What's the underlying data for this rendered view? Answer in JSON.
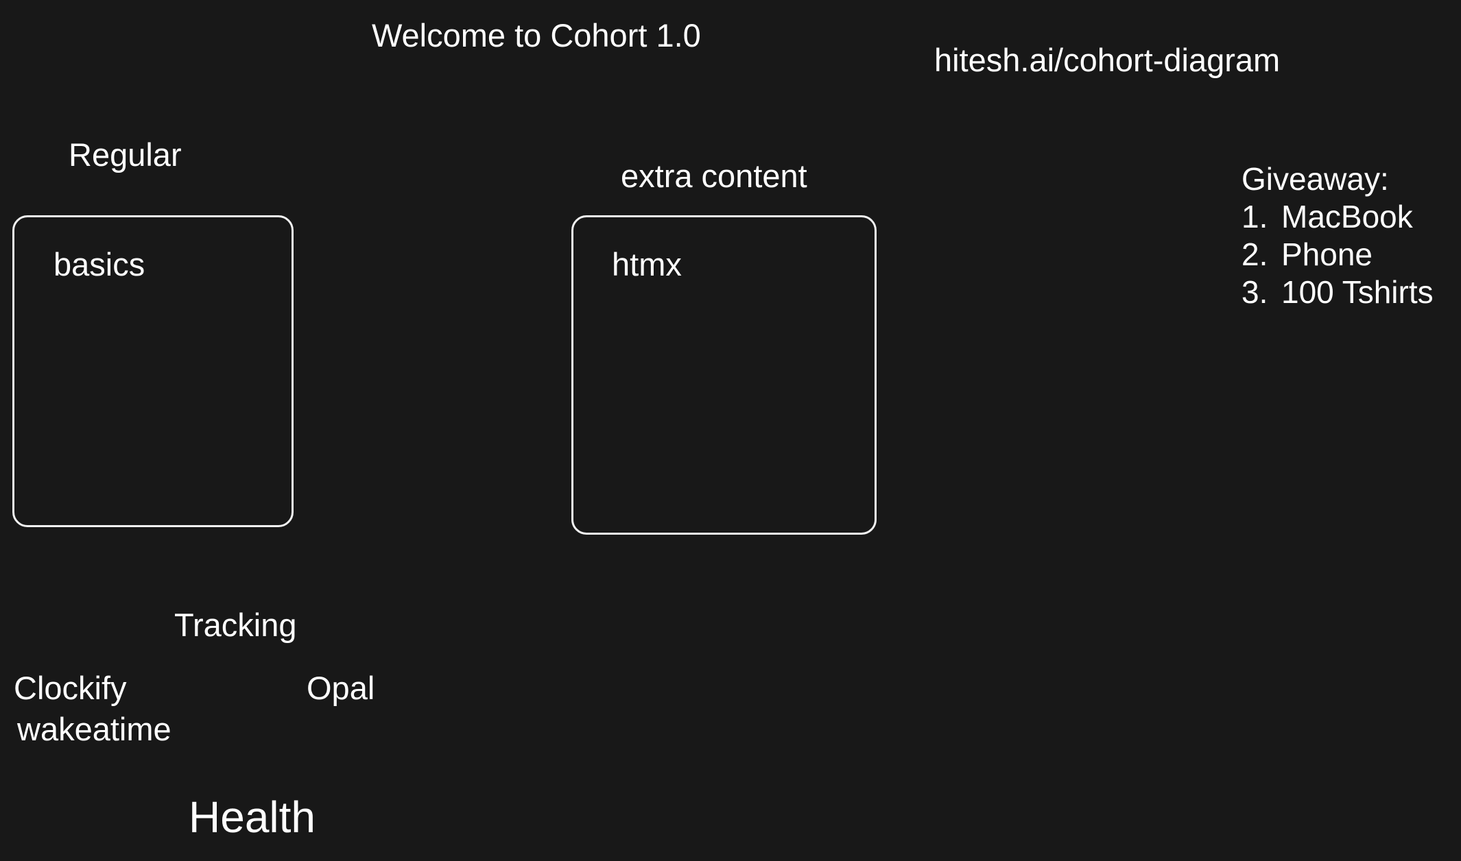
{
  "canvas": {
    "background": "#181818",
    "stroke_color": "#f2f2f2",
    "text_color": "#ffffff"
  },
  "header": {
    "title": "Welcome to Cohort 1.0",
    "link": "hitesh.ai/cohort-diagram"
  },
  "sections": {
    "regular": {
      "heading": "Regular",
      "box_label": "basics"
    },
    "extra": {
      "heading": "extra content",
      "box_label": "htmx"
    }
  },
  "giveaway": {
    "heading": "Giveaway:",
    "items": [
      {
        "num": "1.",
        "label": "MacBook"
      },
      {
        "num": "2.",
        "label": "Phone"
      },
      {
        "num": "3.",
        "label": "100 Tshirts"
      }
    ]
  },
  "tracking": {
    "heading": "Tracking",
    "tools": [
      "Clockify",
      "wakeatime",
      "Opal"
    ]
  },
  "health": {
    "heading": "Health"
  }
}
